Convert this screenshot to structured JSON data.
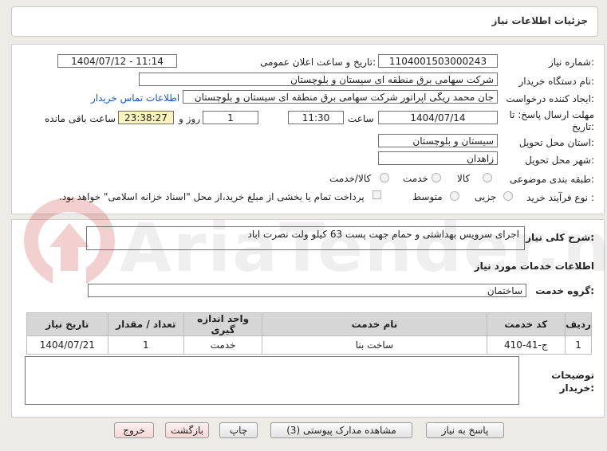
{
  "header": {
    "title": "جزئیات اطلاعات نیاز"
  },
  "fields": {
    "need_number": {
      "label": "شماره نیاز:",
      "value": "1104001503000243"
    },
    "announce_datetime": {
      "label": "تاریخ و ساعت اعلان عمومی:",
      "value": "1404/07/12 - 11:14"
    },
    "buyer_org": {
      "label": "نام دستگاه خریدار:",
      "value": "شرکت سهامی برق منطقه ای سیستان و بلوچستان"
    },
    "requester": {
      "label": "ایجاد کننده درخواست:",
      "value": "جان محمد ریگی اپراتور شرکت سهامی برق منطقه ای سیستان و بلوچستان",
      "contact_link": "اطلاعات تماس خریدار"
    },
    "deadline": {
      "label": "مهلت ارسال پاسخ: تا تاریخ:",
      "date": "1404/07/14",
      "time_label": "ساعت",
      "time": "11:30",
      "days": "1",
      "days_label": "روز و",
      "remaining": "23:38:27",
      "remaining_label": "ساعت باقی مانده"
    },
    "province": {
      "label": "استان محل تحویل:",
      "value": "سیستان و بلوچستان"
    },
    "city": {
      "label": "شهر محل تحویل:",
      "value": "زاهدان"
    },
    "category": {
      "label": "طبقه بندی موضوعی:",
      "options": [
        "کالا",
        "خدمت",
        "کالا/خدمت"
      ],
      "selected": ""
    },
    "purchase_type": {
      "label": "نوع فرآیند خرید :",
      "options": [
        "جزیی",
        "متوسط"
      ],
      "note": "پرداخت تمام یا بخشی از مبلغ خرید،از محل \"اسناد خزانه اسلامی\" خواهد بود."
    }
  },
  "description": {
    "label": "شرح کلی نیاز:",
    "value": "اجرای سرویس بهداشتی و حمام جهت پست 63 کیلو ولت نصرت اباد"
  },
  "services": {
    "heading": "اطلاعات خدمات مورد نیاز",
    "group_label": "گروه خدمت:",
    "group_value": "ساختمان",
    "columns": [
      "ردیف",
      "کد خدمت",
      "نام خدمت",
      "واحد اندازه گیری",
      "تعداد / مقدار",
      "تاریخ نیاز"
    ],
    "rows": [
      {
        "row": "1",
        "code": "ج-41-410",
        "name": "ساخت بنا",
        "unit": "خدمت",
        "qty": "1",
        "date": "1404/07/21"
      }
    ]
  },
  "buyer_notes": {
    "label_line1": "توضیحات",
    "label_line2": "خریدار:",
    "value": ""
  },
  "buttons": {
    "reply": "پاسخ به نیاز",
    "attachments": "مشاهده مدارک پیوستی (3)",
    "print": "چاپ",
    "back": "بازگشت",
    "exit": "خروج"
  },
  "watermark": {
    "text": "AriaTender.neT"
  },
  "colors": {
    "link": "#1a56c8",
    "remaining_bg": "#f8f3bf",
    "table_header_bg": "#d6d6d6",
    "page_bg": "#ecebe6"
  }
}
